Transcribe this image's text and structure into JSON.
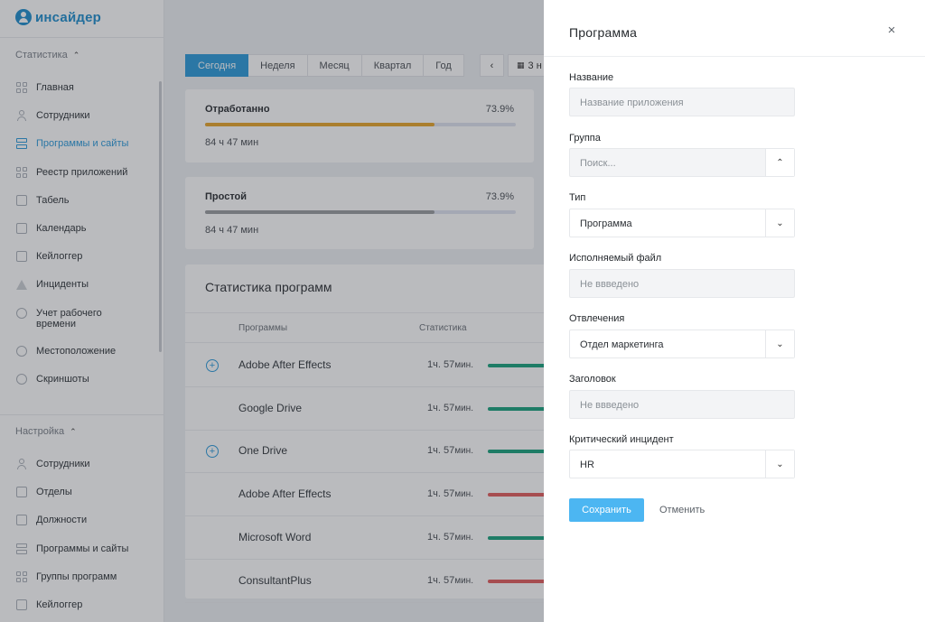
{
  "app": {
    "logo_text": "инсайдер"
  },
  "sidebar": {
    "stats_section": "Статистика",
    "stats_items": [
      {
        "label": "Главная",
        "icon": "grid-icon"
      },
      {
        "label": "Сотрудники",
        "icon": "user-icon"
      },
      {
        "label": "Программы и сайты",
        "icon": "stack-icon",
        "active": true
      },
      {
        "label": "Реестр приложений",
        "icon": "grid-icon"
      },
      {
        "label": "Табель",
        "icon": "table-icon"
      },
      {
        "label": "Календарь",
        "icon": "calendar-icon"
      },
      {
        "label": "Кейлоггер",
        "icon": "keyboard-icon"
      },
      {
        "label": "Инциденты",
        "icon": "warning-icon"
      },
      {
        "label": "Учет рабочего времени",
        "icon": "clock-icon"
      },
      {
        "label": "Местоположение",
        "icon": "location-icon"
      },
      {
        "label": "Скриншоты",
        "icon": "screenshot-icon"
      }
    ],
    "settings_section": "Настройка",
    "settings_items": [
      {
        "label": "Сотрудники",
        "icon": "user-icon"
      },
      {
        "label": "Отделы",
        "icon": "department-icon"
      },
      {
        "label": "Должности",
        "icon": "badge-icon"
      },
      {
        "label": "Программы и сайты",
        "icon": "stack-icon"
      },
      {
        "label": "Группы программ",
        "icon": "grid-icon"
      },
      {
        "label": "Кейлоггер",
        "icon": "keyboard-icon"
      }
    ]
  },
  "period_tabs": [
    "Сегодня",
    "Неделя",
    "Месяц",
    "Квартал",
    "Год"
  ],
  "period_active": 0,
  "period_nav": {
    "prev": "‹",
    "range_label": "3 н"
  },
  "cards": [
    {
      "title": "Отработанно",
      "percent_label": "73.9%",
      "fill": 0.739,
      "duration": "84 ч 47 мин",
      "color": "#e8a52b"
    },
    {
      "title": "Простой",
      "percent_label": "73.9%",
      "fill": 0.739,
      "duration": "84 ч 47 мин",
      "color": "#9a9c9f"
    }
  ],
  "stats": {
    "title": "Статистика программ",
    "col_programs": "Программы",
    "col_stats": "Статистика",
    "rows": [
      {
        "name": "Adobe After Effects",
        "hours": "1ч.",
        "minutes": "57",
        "min_unit": "мин.",
        "expandable": true,
        "color": "#1aa27e"
      },
      {
        "name": "Google Drive",
        "hours": "1ч.",
        "minutes": "57",
        "min_unit": "мин.",
        "expandable": false,
        "color": "#1aa27e"
      },
      {
        "name": "One Drive",
        "hours": "1ч.",
        "minutes": "57",
        "min_unit": "мин.",
        "expandable": true,
        "color": "#1aa27e"
      },
      {
        "name": "Adobe After Effects",
        "hours": "1ч.",
        "minutes": "57",
        "min_unit": "мин.",
        "expandable": false,
        "color": "#e25d5d"
      },
      {
        "name": "Microsoft Word",
        "hours": "1ч.",
        "minutes": "57",
        "min_unit": "мин.",
        "expandable": false,
        "color": "#1aa27e"
      },
      {
        "name": "ConsultantPlus",
        "hours": "1ч.",
        "minutes": "57",
        "min_unit": "мин.",
        "expandable": false,
        "color": "#e25d5d"
      }
    ]
  },
  "drawer": {
    "title": "Программа",
    "close": "×",
    "fields": {
      "name": {
        "label": "Название",
        "placeholder": "Название приложения"
      },
      "group": {
        "label": "Группа",
        "placeholder": "Поиск...",
        "chevron": "up"
      },
      "type": {
        "label": "Тип",
        "value": "Программа",
        "chevron": "down"
      },
      "exe": {
        "label": "Исполняемый файл",
        "placeholder": "Не ввведено"
      },
      "distraction": {
        "label": "Отвлечения",
        "value": "Отдел маркетинга",
        "chevron": "down"
      },
      "window_title": {
        "label": "Заголовок",
        "placeholder": "Не ввведено"
      },
      "critical": {
        "label": "Критический инцидент",
        "value": "HR",
        "chevron": "down"
      }
    },
    "save_label": "Сохранить",
    "cancel_label": "Отменить"
  }
}
